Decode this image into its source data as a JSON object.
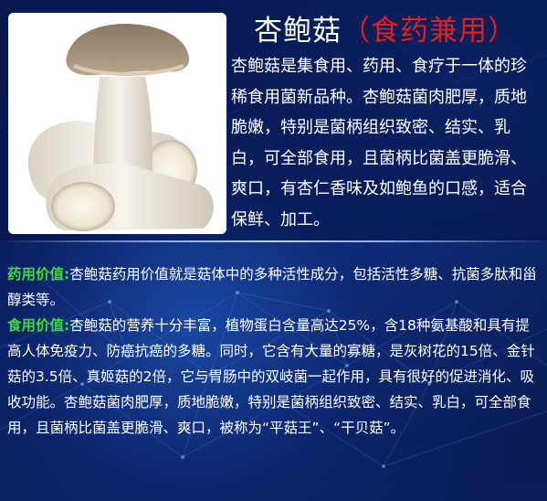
{
  "header": {
    "title": "杏鲍菇",
    "open_paren": "（",
    "tag": "食药兼用",
    "close_paren": "）"
  },
  "intro": {
    "text": "杏鲍菇是集食用、药用、食疗于一体的珍稀食用菌新品种。杏鲍菇菌肉肥厚，质地脆嫩，特别是菌柄组织致密、结实、乳白，可全部食用，且菌柄比菌盖更脆滑、爽口，有杏仁香味及如鲍鱼的口感，适合保鲜、加工。"
  },
  "medicinal": {
    "label": "药用价值:",
    "text": "杏鲍菇药用价值就是菇体中的多种活性成分，包括活性多糖、抗菌多肽和甾醇类等。"
  },
  "edible": {
    "label": "食用价值:",
    "text": "杏鲍菇的营养十分丰富，植物蛋白含量高达25%，含18种氨基酸和具有提高人体免疫力、防癌抗癌的多糖。同时，它含有大量的寡糖，是灰树花的15倍、金针菇的3.5倍、真姬菇的2倍，它与胃肠中的双岐菌一起作用，具有很好的促进消化、吸收功能。杏鲍菇菌肉肥厚，质地脆嫩，特别是菌柄组织致密、结实、乳白，可全部食用，且菌柄比菌盖更脆滑、爽口，被称为“平菇王”、“干贝菇”。"
  },
  "colors": {
    "title": "#ffffff",
    "accent_red": "#e02020",
    "label_green": "#3fdc3f",
    "background": "#0a1a4a"
  }
}
